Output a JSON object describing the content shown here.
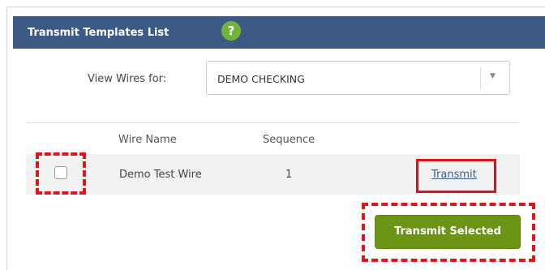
{
  "panel": {
    "title": "Transmit Templates List",
    "help_icon": "question-circle-icon",
    "help_icon_glyph": "?"
  },
  "filter": {
    "label": "View Wires for:",
    "selected_value": "DEMO CHECKING",
    "dropdown_icon": "caret-down-icon"
  },
  "table": {
    "columns": [
      "Wire Name",
      "Sequence"
    ],
    "rows": [
      {
        "checked": false,
        "wire_name": "Demo Test Wire",
        "sequence": "1",
        "action_label": "Transmit"
      }
    ]
  },
  "actions": {
    "transmit_selected_label": "Transmit Selected"
  },
  "colors": {
    "header_bg": "#3c5a83",
    "help_icon": "#72b43b",
    "primary_button": "#6c9415",
    "link": "#3c5a93",
    "highlight": "#e3141b"
  }
}
